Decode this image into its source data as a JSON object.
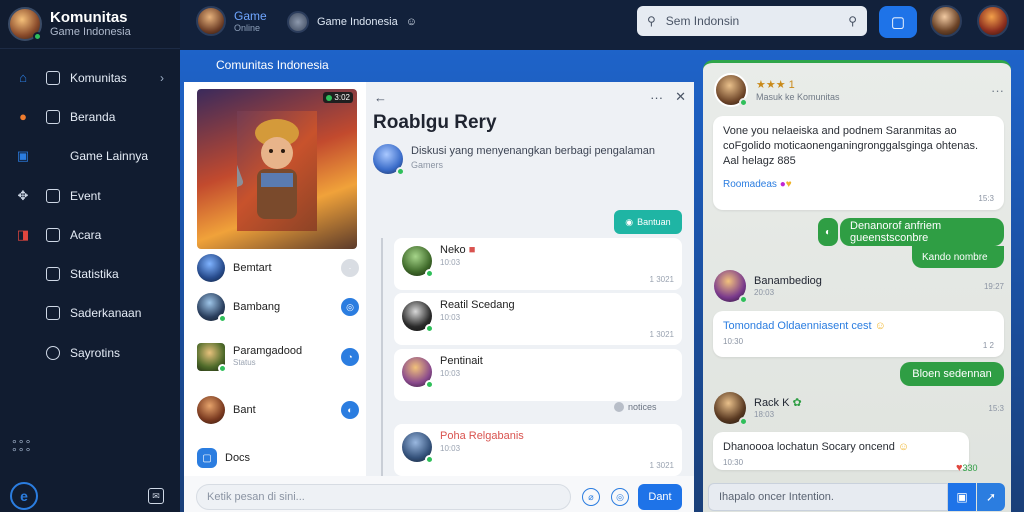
{
  "sidebar": {
    "brand_title": "Komunitas",
    "brand_subtitle": "Game Indonesia",
    "items": [
      {
        "label": "Komunitas",
        "icon": "home-icon"
      },
      {
        "label": "Beranda",
        "icon": "fire-icon"
      },
      {
        "label": "Game Lainnya",
        "icon": "gamepad-icon"
      },
      {
        "label": "Event",
        "icon": "puzzle-icon"
      },
      {
        "label": "Acara",
        "icon": "red-square-icon"
      },
      {
        "label": "Statistika",
        "icon": "box-icon"
      },
      {
        "label": "Saderkanaan",
        "icon": "box-icon"
      },
      {
        "label": "Sayrotins",
        "icon": "box-icon"
      }
    ]
  },
  "topbar": {
    "user1_title": "Game",
    "user1_sub": "Online",
    "user2_title": "Game Indonesia",
    "search_placeholder": "Sem Indonsin"
  },
  "main": {
    "band_title": "Comunitas  Indonesia"
  },
  "left": {
    "hero_badge": "3:02",
    "members": [
      {
        "name": "Bemtart",
        "sub": ""
      },
      {
        "name": "Bambang",
        "sub": ""
      },
      {
        "name": "Paramgadood",
        "sub": "Status"
      },
      {
        "name": "Bant",
        "sub": ""
      },
      {
        "name": "Docs",
        "sub": ""
      }
    ]
  },
  "center": {
    "post_title": "Roablgu Rery",
    "post_desc": "Diskusi yang menyenangkan berbagi pengalaman",
    "post_desc_sub": "Gamers",
    "tag_label": "Bantuan",
    "comments": [
      {
        "name": "Neko",
        "sub": "10:03",
        "time": "1 3021"
      },
      {
        "name": "Reatil Scedang",
        "sub": "10:03",
        "time": "1 3021"
      },
      {
        "name": "Pentinait",
        "sub": "10:03",
        "time": ""
      },
      {
        "name": "Poha Relgabanis",
        "sub": "10:03",
        "time": "1 3021"
      }
    ],
    "notice": "notices",
    "input_placeholder": "Ketik pesan di sini...",
    "send_label": "Dant"
  },
  "chat": {
    "header_name": "★★★ 1",
    "header_status": "Masuk ke Komunitas",
    "msg1": "Vone you nelaeiska and podnem Saranmitas ao coFgolido moticaonenganingronggalsginga ohtenas. Aal helagz 885",
    "msg1_footer": "Roomadeas",
    "msg1_time": "15:3",
    "green1": "Denanorof anfriem gueenstsconbre",
    "green1_sub": "Kando nombre",
    "msg2_name": "Banambediog",
    "msg2_status": "20:03",
    "msg2": "Tomondad Oldaenniasent cest",
    "msg2_sub": "10:30",
    "msg2_time": "1 2",
    "green2": "Bloen sedennan",
    "msg3_name": "Rack K",
    "msg3_status": "18:03",
    "msg3": "Dhanoooa lochatun Socary oncend",
    "msg3_sub": "10:30",
    "msg3_time": "15:3",
    "input_placeholder": "Ihapalo oncer Intention."
  }
}
